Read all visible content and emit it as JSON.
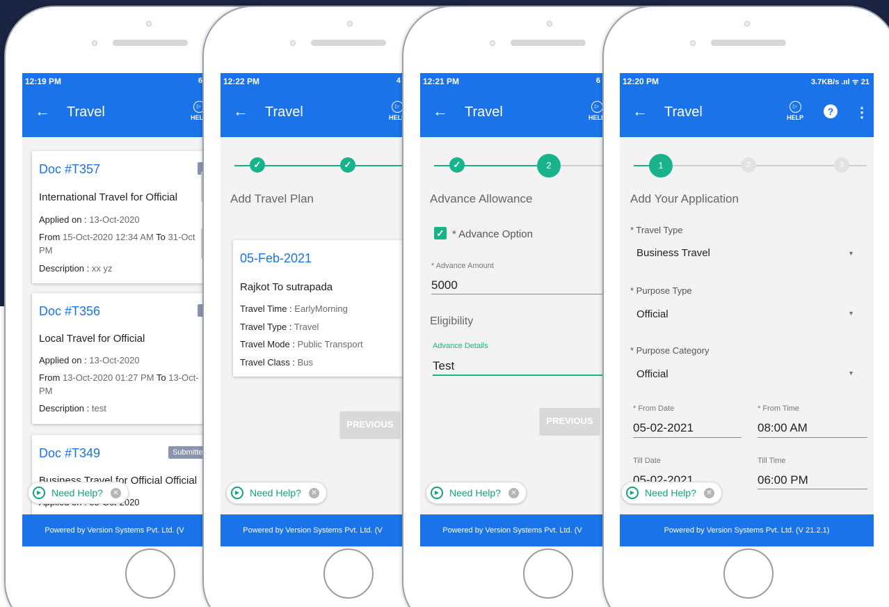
{
  "colors": {
    "primary": "#1a73e8",
    "accent": "#18b38a",
    "background_dark": "#1c2443"
  },
  "common": {
    "app_title": "Travel",
    "help_label": "HELP",
    "need_help": "Need Help?"
  },
  "phone1": {
    "time": "12:19 PM",
    "status_right": "6",
    "footer": "Powered by Version Systems Pvt. Ltd. (V",
    "cards": [
      {
        "doc": "Doc #T357",
        "badge": "I",
        "title": "International Travel for  Official",
        "applied_label": "Applied on :",
        "applied": "13-Oct-2020",
        "from_label": "From",
        "from": "15-Oct-2020 12:34 AM",
        "to_label": "To",
        "to": "31-Oct",
        "to_line2": "PM",
        "desc_label": "Description :",
        "desc": "xx yz"
      },
      {
        "doc": "Doc #T356",
        "badge": "I",
        "title": "Local Travel for  Official",
        "applied_label": "Applied on :",
        "applied": "13-Oct-2020",
        "from_label": "From",
        "from": "13-Oct-2020 01:27 PM",
        "to_label": "To",
        "to": "13-Oct-",
        "to_line2": "PM",
        "desc_label": "Description :",
        "desc": "test"
      },
      {
        "doc": "Doc #T349",
        "badge": "Submitte",
        "title": "Business Travel for Official Official",
        "applied_partial": "Applied on : 05-Oct-2020"
      }
    ]
  },
  "phone2": {
    "time": "12:22 PM",
    "status_right": "4",
    "footer": "Powered by Version Systems Pvt. Ltd. (V",
    "section_title": "Add Travel Plan",
    "plan": {
      "date": "05-Feb-2021",
      "route": "Rajkot To sutrapada",
      "rows": [
        {
          "label": "Travel Time :",
          "value": "EarlyMorning"
        },
        {
          "label": "Travel Type :",
          "value": "Travel"
        },
        {
          "label": "Travel Mode :",
          "value": "Public Transport"
        },
        {
          "label": "Travel Class :",
          "value": "Bus"
        }
      ]
    },
    "previous": "PREVIOUS"
  },
  "phone3": {
    "time": "12:21 PM",
    "status_right": "6",
    "footer": "Powered by Version Systems Pvt. Ltd. (V",
    "step_active": "2",
    "section_title": "Advance Allowance",
    "advance_option": "* Advance Option",
    "advance_amount_label": "* Advance Amount",
    "advance_amount": "5000",
    "eligibility": "Eligibility",
    "advance_details_label": "Advance Details",
    "advance_details": "Test",
    "previous": "PREVIOUS"
  },
  "phone4": {
    "time": "12:20 PM",
    "status_right": "3.7KB/s .ııl ᯤ 21",
    "footer": "Powered by Version Systems Pvt. Ltd. (V 21.2.1)",
    "steps": [
      "1",
      "2",
      "3"
    ],
    "section_title": "Add Your Application",
    "travel_type_label": "* Travel Type",
    "travel_type": "Business Travel",
    "purpose_type_label": "* Purpose Type",
    "purpose_type": "Official",
    "purpose_category_label": "* Purpose Category",
    "purpose_category": "Official",
    "from_date_label": "* From Date",
    "from_date": "05-02-2021",
    "from_time_label": "* From Time",
    "from_time": "08:00 AM",
    "till_date_label": "Till Date",
    "till_date": "05-02-2021",
    "till_time_label": "Till Time",
    "till_time": "06:00 PM"
  }
}
